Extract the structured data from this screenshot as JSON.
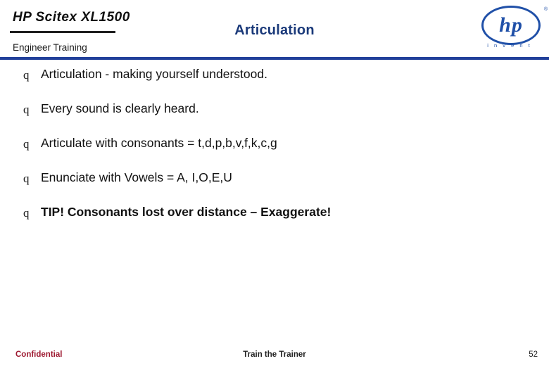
{
  "header": {
    "brand_wordmark": "HP Scitex XL1500",
    "brand_sub": "Engineer  Training",
    "slide_title": "Articulation",
    "logo": {
      "letters": "hp",
      "tagline": "i n v e n t",
      "registered": "®"
    }
  },
  "body": {
    "bullet_marker": "q",
    "bullets": [
      {
        "text": "Articulation - making yourself understood.",
        "emphasis": false
      },
      {
        "text": "Every sound is clearly heard.",
        "emphasis": false
      },
      {
        "text": "Articulate with consonants = t,d,p,b,v,f,k,c,g",
        "emphasis": false
      },
      {
        "text": "Enunciate with Vowels = A, I,O,E,U",
        "emphasis": false
      },
      {
        "text": "TIP! Consonants lost over distance – Exaggerate!",
        "emphasis": true
      }
    ]
  },
  "footer": {
    "confidential": "Confidential",
    "center": "Train the Trainer",
    "page_number": "52"
  },
  "colors": {
    "title_blue": "#1b3a7a",
    "rule_blue": "#21409a",
    "logo_blue": "#2050a8",
    "confidential_red": "#9e1b32"
  }
}
